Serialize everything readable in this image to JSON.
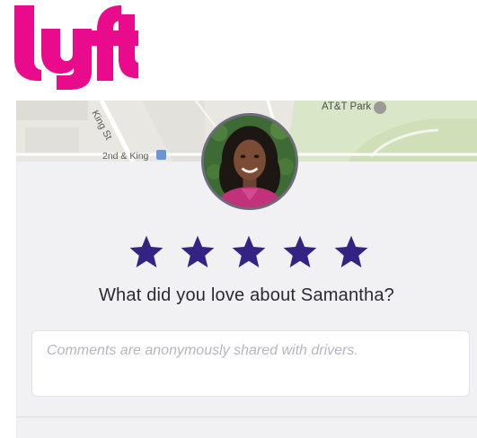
{
  "brand": {
    "logo_text": "lyft",
    "color": "#ea0b8c"
  },
  "map": {
    "labels": {
      "att_park": "AT&T Park",
      "king_st": "King St",
      "second_and_king": "2nd & King"
    },
    "icons": [
      "ballpark-icon",
      "transit-icon"
    ]
  },
  "driver": {
    "name": "Samantha",
    "avatar_icon": "driver-avatar"
  },
  "rating": {
    "value": 5,
    "max": 5,
    "star_color": "#352384"
  },
  "feedback": {
    "prompt": "What did you love about Samantha?",
    "placeholder": "Comments are anonymously shared with drivers.",
    "value": ""
  }
}
